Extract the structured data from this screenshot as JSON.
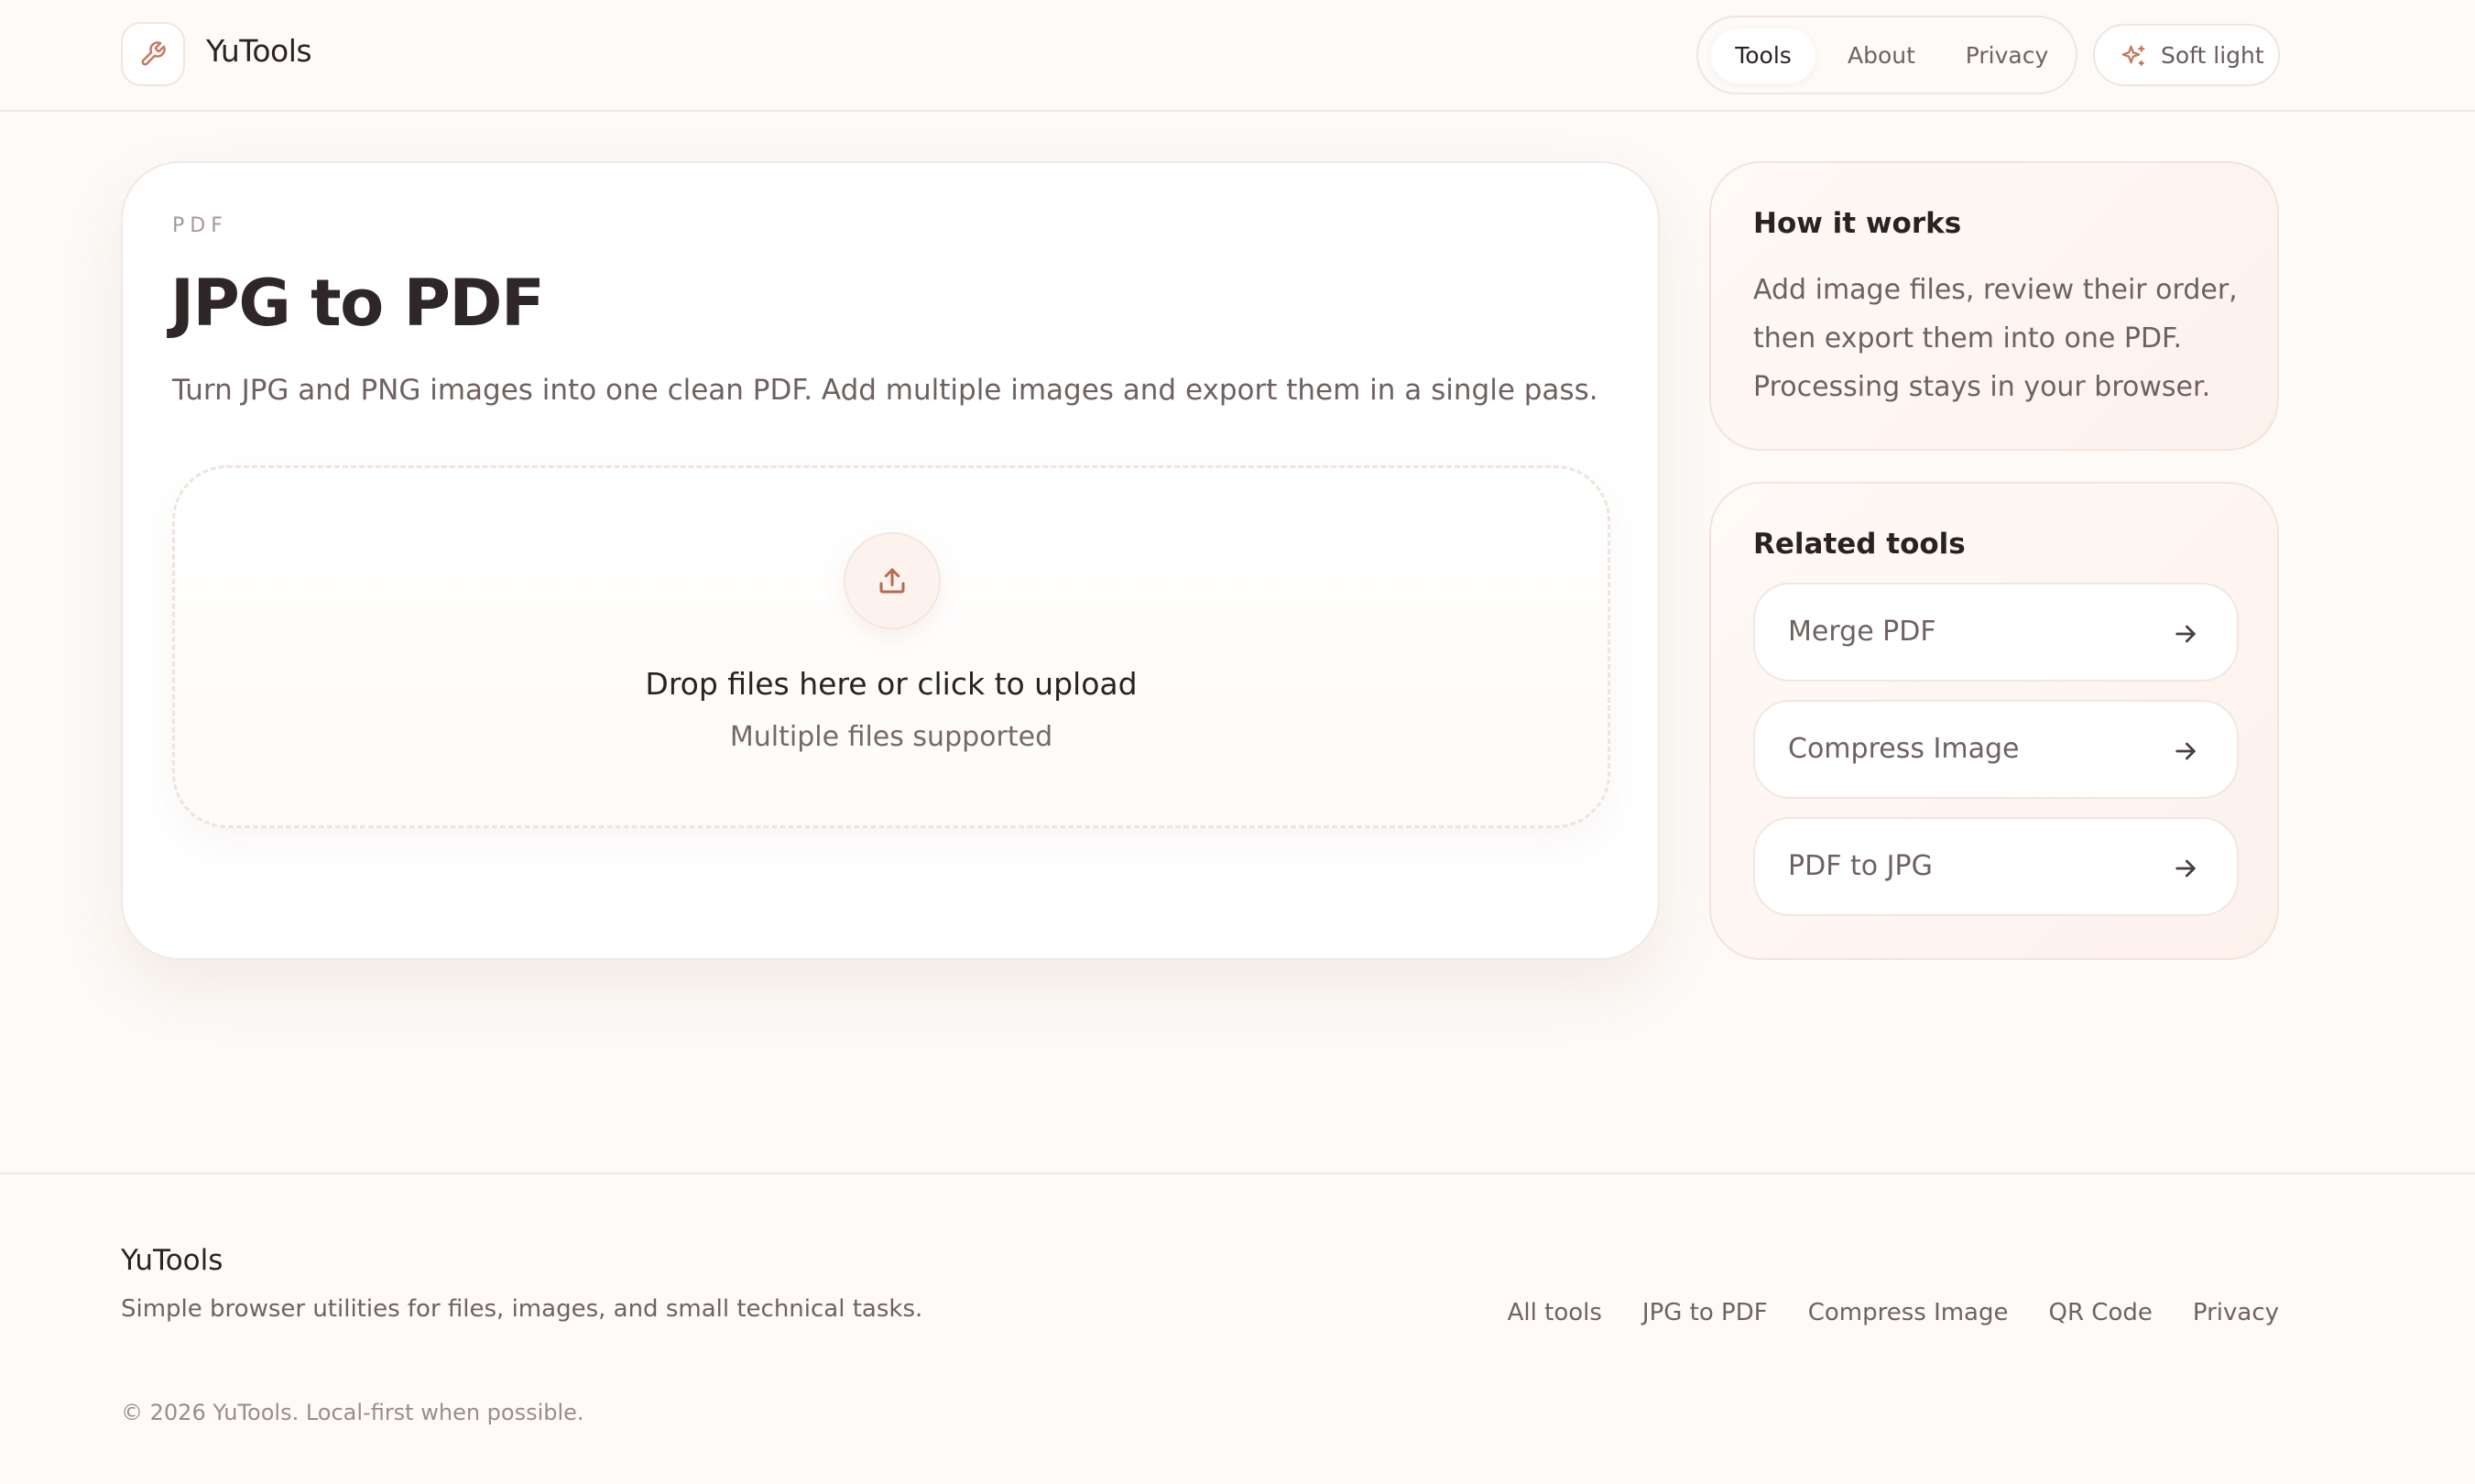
{
  "header": {
    "brand": "YuTools",
    "logo_icon": "wrench-icon",
    "nav": [
      {
        "label": "Tools",
        "active": true
      },
      {
        "label": "About",
        "active": false
      },
      {
        "label": "Privacy",
        "active": false
      }
    ],
    "theme_button": {
      "label": "Soft light",
      "icon": "sparkle-icon"
    }
  },
  "main": {
    "eyebrow": "PDF",
    "title": "JPG to PDF",
    "description": "Turn JPG and PNG images into one clean PDF. Add multiple images and export them in a single pass.",
    "dropzone": {
      "icon": "upload-icon",
      "title": "Drop files here or click to upload",
      "subtitle": "Multiple files supported"
    }
  },
  "how_it_works": {
    "title": "How it works",
    "text": "Add image files, review their order, then export them into one PDF. Processing stays in your browser."
  },
  "related_tools": {
    "title": "Related tools",
    "items": [
      {
        "label": "Merge PDF",
        "icon": "arrow-right-icon"
      },
      {
        "label": "Compress Image",
        "icon": "arrow-right-icon"
      },
      {
        "label": "PDF to JPG",
        "icon": "arrow-right-icon"
      }
    ]
  },
  "footer": {
    "brand": "YuTools",
    "description": "Simple browser utilities for files, images, and small technical tasks.",
    "links": [
      "All tools",
      "JPG to PDF",
      "Compress Image",
      "QR Code",
      "Privacy"
    ],
    "copyright": "© 2026 YuTools. Local-first when possible."
  },
  "colors": {
    "background": "#fdfaf7",
    "accent": "#c8785c",
    "text": "#2f2626",
    "muted": "#6f6161"
  }
}
